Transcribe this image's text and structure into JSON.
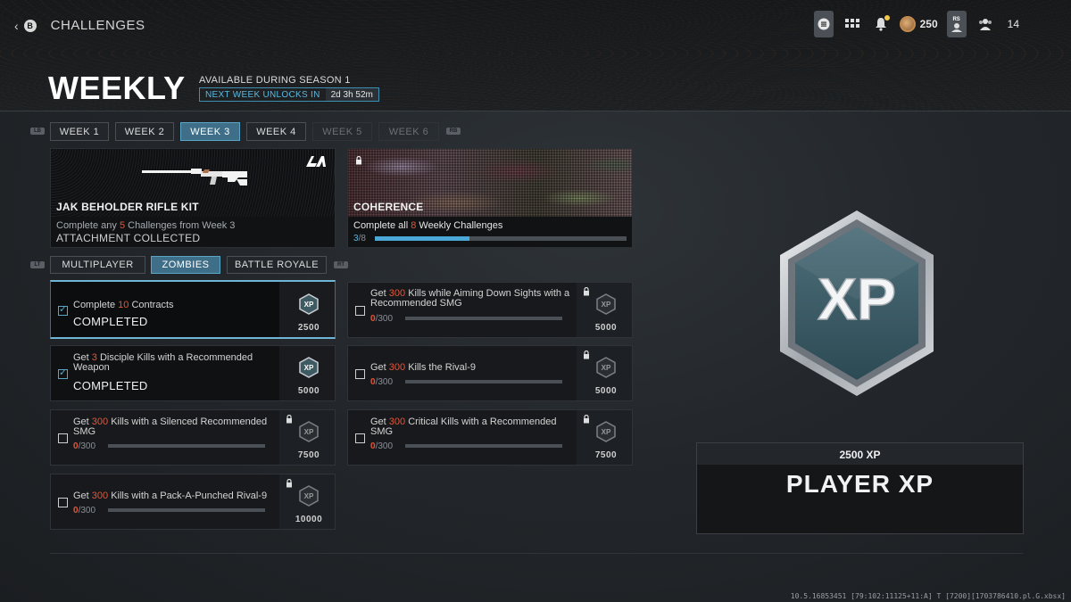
{
  "topbar": {
    "back_button": "B",
    "breadcrumb": "CHALLENGES",
    "currency": "250",
    "level": "14",
    "profile_badge": "RS"
  },
  "header": {
    "title": "WEEKLY",
    "available": "AVAILABLE DURING SEASON 1",
    "next_unlock_label": "NEXT WEEK UNLOCKS IN",
    "next_unlock_time": "2d 3h 52m"
  },
  "week_tabs": {
    "left_bumper": "LB",
    "right_bumper": "RB",
    "tabs": [
      {
        "label": "WEEK 1",
        "state": "normal"
      },
      {
        "label": "WEEK 2",
        "state": "normal"
      },
      {
        "label": "WEEK 3",
        "state": "active"
      },
      {
        "label": "WEEK 4",
        "state": "normal"
      },
      {
        "label": "WEEK 5",
        "state": "locked"
      },
      {
        "label": "WEEK 6",
        "state": "locked"
      }
    ]
  },
  "rewards": {
    "kit": {
      "title": "JAK BEHOLDER RIFLE KIT",
      "desc_pre": "Complete any ",
      "desc_num": "5",
      "desc_post": " Challenges from Week 3",
      "status": "ATTACHMENT COLLECTED",
      "brand_icon": "jak-brand-icon"
    },
    "camo": {
      "title": "COHERENCE",
      "desc_pre": "Complete all ",
      "desc_num": "8",
      "desc_post": " Weekly Challenges",
      "progress_cur": "3",
      "progress_sep": "/",
      "progress_total": "8",
      "progress_fraction": 0.375
    }
  },
  "mode_tabs": {
    "left_trigger": "LT",
    "right_trigger": "RT",
    "tabs": [
      {
        "label": "MULTIPLAYER",
        "state": "normal"
      },
      {
        "label": "ZOMBIES",
        "state": "active"
      },
      {
        "label": "BATTLE ROYALE",
        "state": "normal"
      }
    ]
  },
  "challenges": [
    {
      "pre": "Complete ",
      "num": "10",
      "post": " Contracts",
      "status": "COMPLETED",
      "xp": "2500",
      "completed": true,
      "locked": false
    },
    {
      "pre": "Get ",
      "num": "3",
      "post": " Disciple Kills with a Recommended Weapon",
      "status": "COMPLETED",
      "xp": "5000",
      "completed": true,
      "locked": false
    },
    {
      "pre": "Get ",
      "num": "300",
      "post": " Kills with a Silenced Recommended SMG",
      "cur": "0",
      "total": "/300",
      "xp": "7500",
      "completed": false,
      "locked": true,
      "progress_fraction": 0
    },
    {
      "pre": "Get ",
      "num": "300",
      "post": " Kills with a Pack-A-Punched Rival-9",
      "cur": "0",
      "total": "/300",
      "xp": "10000",
      "completed": false,
      "locked": true,
      "progress_fraction": 0
    },
    {
      "pre": "Get ",
      "num": "300",
      "post": " Kills while Aiming Down Sights with a Recommended SMG",
      "cur": "0",
      "total": "/300",
      "xp": "5000",
      "completed": false,
      "locked": true,
      "progress_fraction": 0
    },
    {
      "pre": "Get ",
      "num": "300",
      "post": " Kills the Rival-9",
      "cur": "0",
      "total": "/300",
      "xp": "5000",
      "completed": false,
      "locked": true,
      "progress_fraction": 0
    },
    {
      "pre": "Get ",
      "num": "300",
      "post": " Critical Kills with a Recommended SMG",
      "cur": "0",
      "total": "/300",
      "xp": "7500",
      "completed": false,
      "locked": true,
      "progress_fraction": 0
    }
  ],
  "xp_panel": {
    "badge_text": "XP",
    "amount": "2500 XP",
    "name": "PLAYER XP"
  },
  "build_string": "10.5.16853451 [79:102:11125+11:A] T [7200][1703786410.pl.G.xbsx]",
  "colors": {
    "accent": "#5aa6c7",
    "highlight": "#e0573a",
    "progress": "#4aa7d6"
  }
}
